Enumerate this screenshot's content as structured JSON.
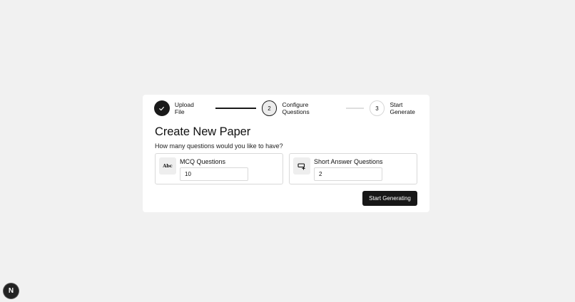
{
  "stepper": {
    "steps": [
      {
        "number": "",
        "label": "Upload File",
        "state": "done"
      },
      {
        "number": "2",
        "label": "Configure Questions",
        "state": "active"
      },
      {
        "number": "3",
        "label": "Start Generate",
        "state": "pending"
      }
    ]
  },
  "main": {
    "title": "Create New Paper",
    "subtitle": "How many questions would you like to have?",
    "mcq": {
      "icon": "abc-icon",
      "icon_text": "Abc",
      "label": "MCQ Questions",
      "value": "10"
    },
    "short": {
      "icon": "text-cursor-plus-icon",
      "label": "Short Answer Questions",
      "value": "2"
    },
    "start_button": "Start Generating"
  },
  "badge": {
    "icon": "nextjs-logo-icon",
    "letter": "N"
  }
}
